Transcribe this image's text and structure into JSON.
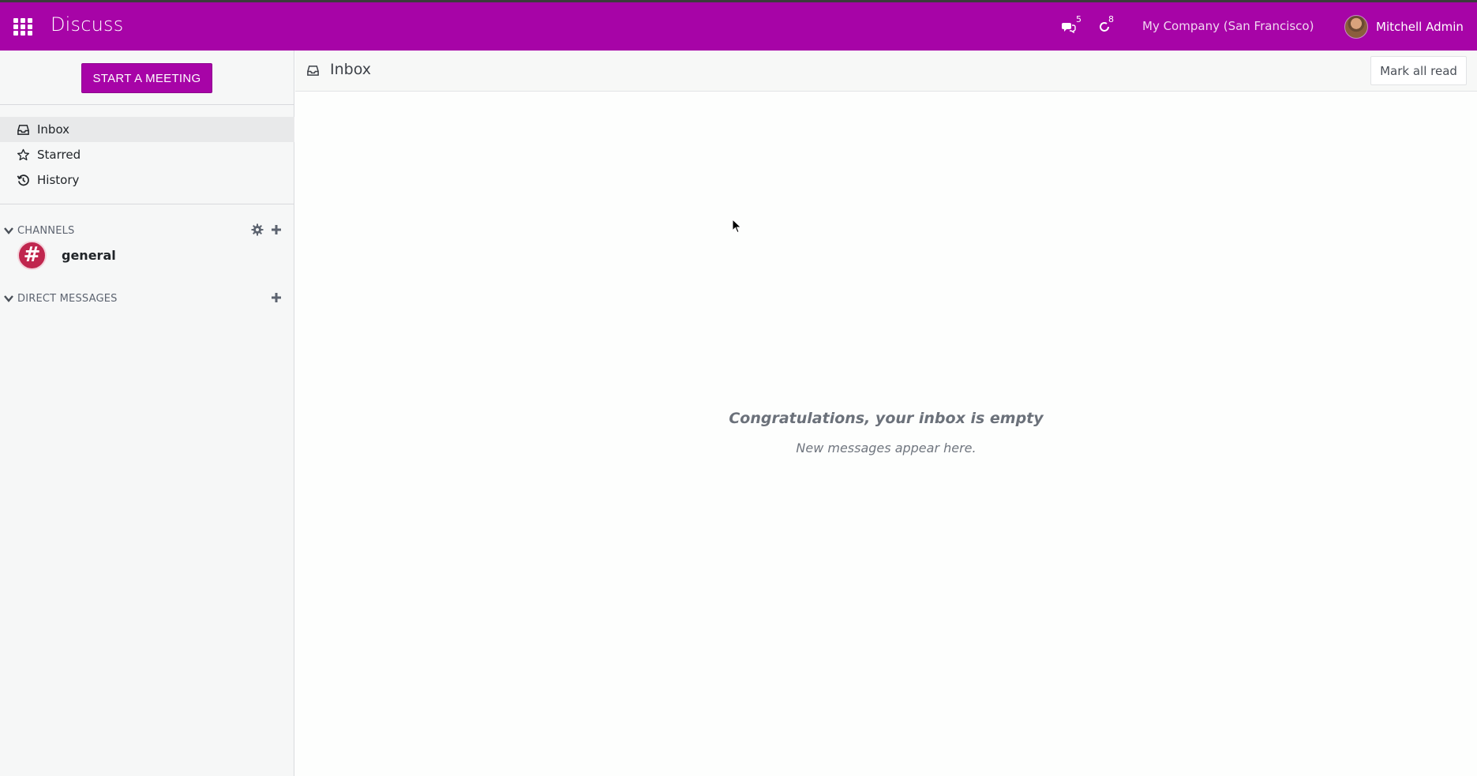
{
  "navbar": {
    "app_title": "Discuss",
    "apps_icon": "grid-icon",
    "messages_badge": "5",
    "activities_badge": "8",
    "company": "My Company (San Francisco)",
    "user_name": "Mitchell Admin",
    "background": "#a704a7"
  },
  "sidebar": {
    "start_meeting_label": "START A MEETING",
    "mailboxes": [
      {
        "label": "Inbox",
        "icon": "inbox-icon",
        "active": true
      },
      {
        "label": "Starred",
        "icon": "star-icon",
        "active": false
      },
      {
        "label": "History",
        "icon": "history-icon",
        "active": false
      }
    ],
    "channels_header": "CHANNELS",
    "channels": [
      {
        "name": "general",
        "avatar_symbol": "#",
        "avatar_color": "#c0264e"
      }
    ],
    "direct_messages_header": "DIRECT MESSAGES"
  },
  "thread": {
    "title": "Inbox",
    "mark_all_read_label": "Mark all read",
    "empty_title": "Congratulations, your inbox is empty",
    "empty_subtitle": "New messages appear here."
  }
}
